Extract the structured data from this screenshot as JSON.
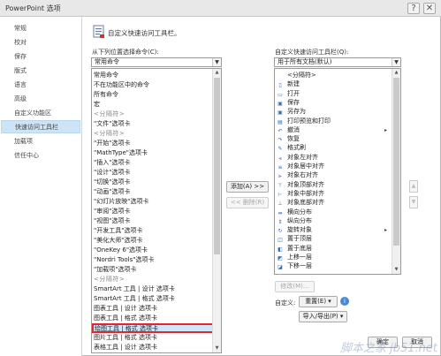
{
  "window": {
    "title": "PowerPoint 选项"
  },
  "nav": {
    "items": [
      "常规",
      "校对",
      "保存",
      "版式",
      "语言",
      "高级",
      "自定义功能区",
      "快速访问工具栏",
      "加载项",
      "信任中心"
    ],
    "selected_index": 7
  },
  "header": {
    "title": "自定义快速访问工具栏。"
  },
  "left": {
    "choose_label": "从下列位置选择命令(C):",
    "choose_value": "常用命令",
    "items": [
      "常用命令",
      "不在功能区中的命令",
      "所有命令",
      "宏",
      "<分隔符>",
      "\"文件\"选项卡",
      "<分隔符>",
      "\"开始\"选项卡",
      "\"MathType\"选项卡",
      "\"插入\"选项卡",
      "\"设计\"选项卡",
      "\"切换\"选项卡",
      "\"动画\"选项卡",
      "\"幻灯片放映\"选项卡",
      "\"审阅\"选项卡",
      "\"视图\"选项卡",
      "\"开发工具\"选项卡",
      "\"美化大师\"选项卡",
      "\"OneKey 6\"选项卡",
      "\"Nordri Tools\"选项卡",
      "\"加载项\"选项卡",
      "<分隔符>",
      "SmartArt 工具 | 设计 选项卡",
      "SmartArt 工具 | 格式 选项卡",
      "图表工具 | 设计 选项卡",
      "图表工具 | 格式 选项卡",
      "绘图工具 | 格式 选项卡",
      "图片工具 | 格式 选项卡",
      "表格工具 | 设计 选项卡"
    ],
    "highlighted_index": 26
  },
  "middle": {
    "add_button": "添加(A) >>",
    "remove_button": "<< 删除(R)"
  },
  "right": {
    "customize_label": "自定义快速访问工具栏(Q):",
    "customize_value": "用于所有文档(默认)",
    "items": [
      {
        "label": "<分隔符>",
        "icon": "separator-icon"
      },
      {
        "label": "新建",
        "icon": "new-doc-icon"
      },
      {
        "label": "打开",
        "icon": "open-folder-icon"
      },
      {
        "label": "保存",
        "icon": "save-icon"
      },
      {
        "label": "另存为",
        "icon": "save-as-icon"
      },
      {
        "label": "打印预览和打印",
        "icon": "print-preview-icon"
      },
      {
        "label": "撤消",
        "icon": "undo-icon",
        "submenu": true
      },
      {
        "label": "恢复",
        "icon": "redo-icon"
      },
      {
        "label": "格式刷",
        "icon": "format-painter-icon"
      },
      {
        "label": "对象左对齐",
        "icon": "align-left-icon"
      },
      {
        "label": "对象居中对齐",
        "icon": "align-center-icon"
      },
      {
        "label": "对象右对齐",
        "icon": "align-right-icon"
      },
      {
        "label": "对象顶部对齐",
        "icon": "align-top-icon"
      },
      {
        "label": "对象中部对齐",
        "icon": "align-middle-icon"
      },
      {
        "label": "对象底部对齐",
        "icon": "align-bottom-icon"
      },
      {
        "label": "横向分布",
        "icon": "distribute-horizontal-icon"
      },
      {
        "label": "纵向分布",
        "icon": "distribute-vertical-icon"
      },
      {
        "label": "旋转对象",
        "icon": "rotate-icon",
        "submenu": true
      },
      {
        "label": "置于顶层",
        "icon": "bring-to-front-icon"
      },
      {
        "label": "置于底层",
        "icon": "send-to-back-icon"
      },
      {
        "label": "上移一层",
        "icon": "bring-forward-icon"
      },
      {
        "label": "下移一层",
        "icon": "send-backward-icon"
      }
    ],
    "modify_button": "修改(M)...",
    "customizations_label": "自定义:",
    "reset_button": "重置(E) ▾",
    "import_export_button": "导入/导出(P) ▾"
  },
  "footer": {
    "ok_button": "确定",
    "cancel_button": "取消"
  },
  "watermark": "脚本之家 jb51.net"
}
